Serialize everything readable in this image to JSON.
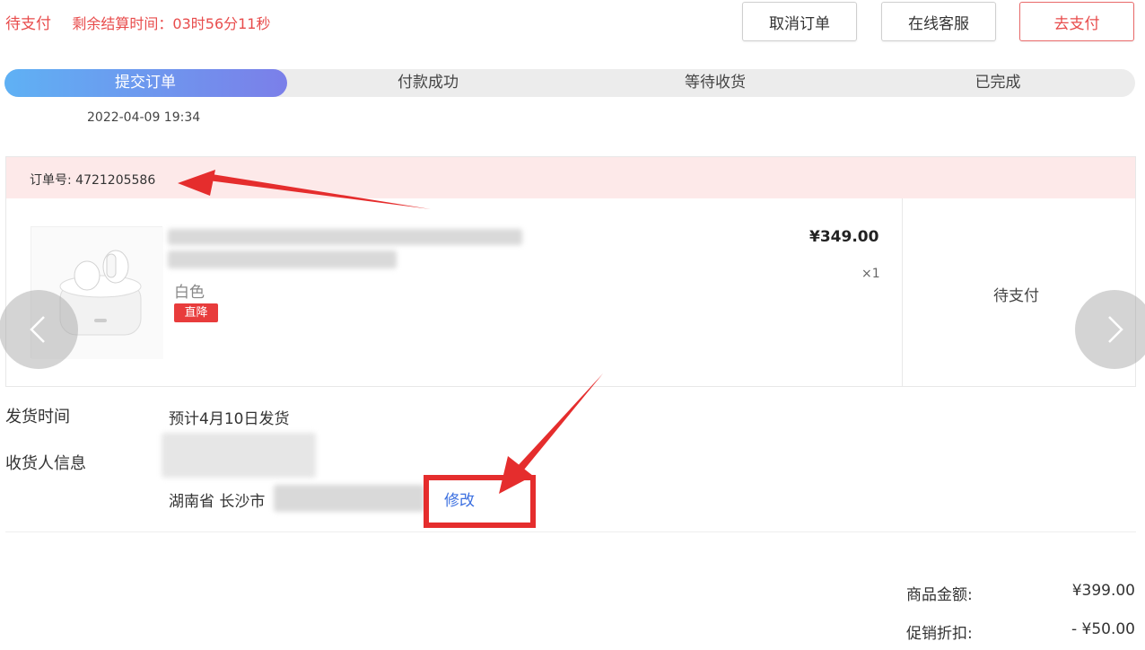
{
  "header": {
    "status": "待支付",
    "countdown": "剩余结算时间：03时56分11秒",
    "buttons": {
      "cancel": "取消订单",
      "service": "在线客服",
      "pay": "去支付"
    }
  },
  "progress": {
    "steps": [
      "提交订单",
      "付款成功",
      "等待收货",
      "已完成"
    ],
    "current": 1,
    "submit_time": "2022-04-09 19:34"
  },
  "order": {
    "order_no": "订单号: 4721205586",
    "product": {
      "variant": "白色",
      "tag": "直降",
      "price": "¥349.00",
      "quantity": "×1"
    },
    "status": "待支付"
  },
  "shipping": {
    "ship_time_label": "发货时间",
    "ship_time_value": "预计4月10日发货",
    "receiver_label": "收货人信息",
    "address_prefix": "湖南省 长沙市",
    "modify": "修改"
  },
  "summary": {
    "goods_amount_label": "商品金额:",
    "goods_amount_value": "¥399.00",
    "discount_label": "促销折扣:",
    "discount_value": "- ¥50.00"
  },
  "colors": {
    "accent_red": "#e84c4c",
    "progress_start": "#5fb1f4",
    "progress_end": "#7b7fe9",
    "link_blue": "#3b6fe0",
    "annotation_red": "#e52d2d"
  }
}
